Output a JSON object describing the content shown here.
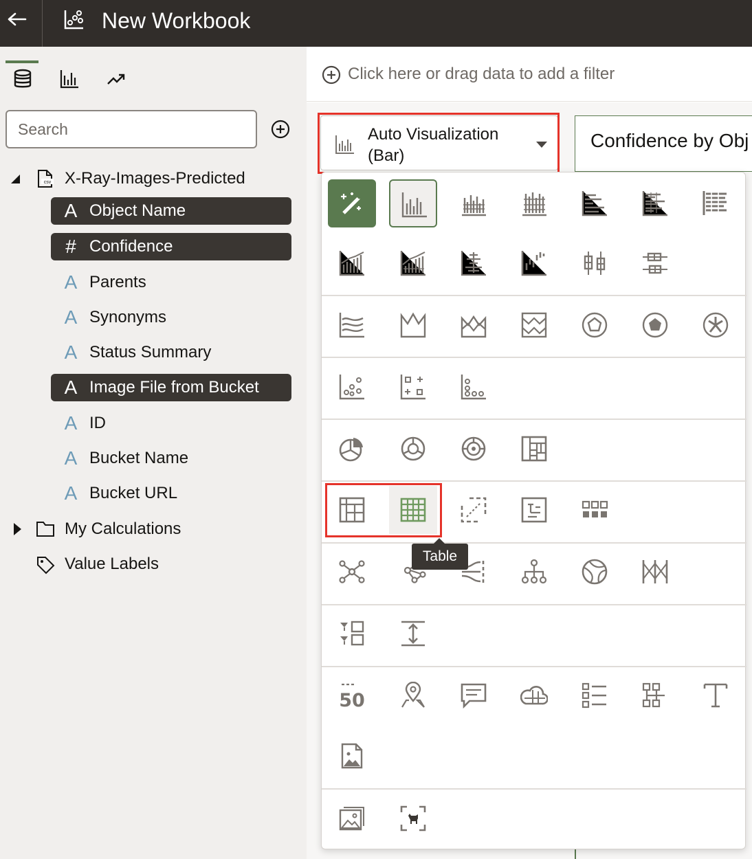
{
  "header": {
    "title": "New Workbook",
    "back_icon": "arrow-left-icon",
    "app_icon": "workbook-chart-icon"
  },
  "left_panel": {
    "tabs": [
      {
        "name": "data",
        "icon": "database-icon",
        "active": true
      },
      {
        "name": "visualizations",
        "icon": "bar-chart-icon",
        "active": false
      },
      {
        "name": "analytics",
        "icon": "trend-icon",
        "active": false
      }
    ],
    "search": {
      "placeholder": "Search",
      "value": ""
    },
    "dataset": {
      "name": "X-Ray-Images-Predicted",
      "fields": [
        {
          "type": "A",
          "label": "Object Name",
          "selected": true
        },
        {
          "type": "#",
          "label": "Confidence",
          "selected": true
        },
        {
          "type": "A",
          "label": "Parents",
          "selected": false
        },
        {
          "type": "A",
          "label": "Synonyms",
          "selected": false
        },
        {
          "type": "A",
          "label": "Status Summary",
          "selected": false
        },
        {
          "type": "A",
          "label": "Image File from Bucket",
          "selected": true
        },
        {
          "type": "A",
          "label": "ID",
          "selected": false
        },
        {
          "type": "A",
          "label": "Bucket Name",
          "selected": false
        },
        {
          "type": "A",
          "label": "Bucket URL",
          "selected": false
        }
      ]
    },
    "my_calculations": "My Calculations",
    "value_labels": "Value Labels"
  },
  "filter_bar": {
    "text": "Click here or drag data to add a filter"
  },
  "viz_selector": {
    "label": "Auto Visualization (Bar)"
  },
  "viz_title": "Confidence by Obj",
  "tooltip": "Table",
  "colors": {
    "accent": "#5a7a4f",
    "header_bg": "#312d2a",
    "highlight": "#e5332a",
    "icon": "#7a7570"
  }
}
